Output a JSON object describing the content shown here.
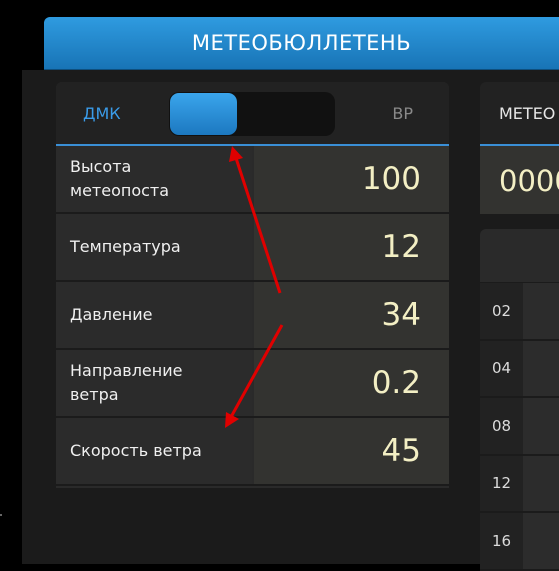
{
  "title": "МЕТЕОБЮЛЛЕТЕНЬ",
  "toggle": {
    "left_label": "ДМК",
    "right_label": "ВР"
  },
  "rows": [
    {
      "label": "Высота метеопоста",
      "value": "100"
    },
    {
      "label": "Температура",
      "value": "12"
    },
    {
      "label": "Давление",
      "value": "34"
    },
    {
      "label": "Направление ветра",
      "value": "0.2"
    },
    {
      "label": "Скорость ветра",
      "value": "45"
    }
  ],
  "side_panel": {
    "header": "МЕТЕО",
    "value": "0000"
  },
  "side_list": [
    "02",
    "04",
    "08",
    "12",
    "16"
  ],
  "colors": {
    "accent": "#2f9be0",
    "annotation_arrow": "#e00000"
  }
}
